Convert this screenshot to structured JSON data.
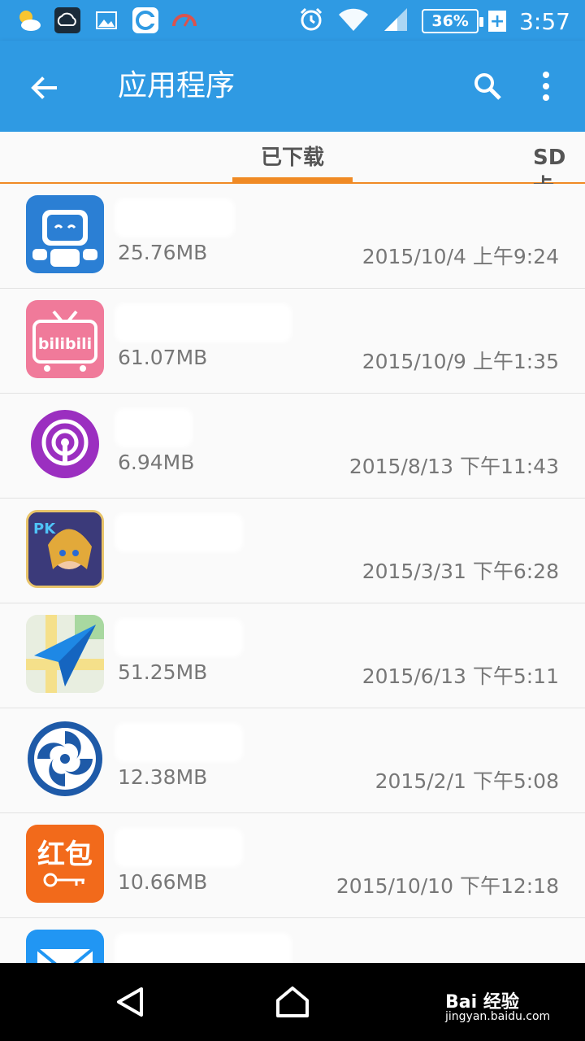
{
  "status_bar": {
    "battery": "36%",
    "time": "3:57",
    "left_icons": [
      "weather-icon",
      "cloud-icon",
      "image-icon",
      "browser-icon",
      "gauge-icon"
    ],
    "right_icons": [
      "alarm-icon",
      "wifi-icon",
      "signal-icon",
      "battery-icon"
    ]
  },
  "app_bar": {
    "title": "应用程序"
  },
  "tabs": [
    {
      "label": "已下载",
      "selected": true
    },
    {
      "label": "SD卡",
      "selected": false
    }
  ],
  "accent_color": "#f08a24",
  "primary_color": "#2f9ae3",
  "apps": [
    {
      "icon": "robot-face-icon",
      "size": "25.76MB",
      "date": "2015/10/4 上午9:24"
    },
    {
      "icon": "bilibili-icon",
      "size": "61.07MB",
      "date": "2015/10/9 上午1:35"
    },
    {
      "icon": "podcast-icon",
      "size": "6.94MB",
      "date": "2015/8/13 下午11:43"
    },
    {
      "icon": "game-character-icon",
      "size": "",
      "date": "2015/3/31 下午6:28"
    },
    {
      "icon": "map-plane-icon",
      "size": "51.25MB",
      "date": "2015/6/13 下午5:11"
    },
    {
      "icon": "spiral-logo-icon",
      "size": "12.38MB",
      "date": "2015/2/1 下午5:08"
    },
    {
      "icon": "red-packet-icon",
      "icon_text": "红包",
      "size": "10.66MB",
      "date": "2015/10/10 下午12:18"
    },
    {
      "icon": "mail-icon",
      "size": "",
      "date": ""
    }
  ],
  "watermark": {
    "brand": "Bai 经验",
    "url": "jingyan.baidu.com"
  }
}
